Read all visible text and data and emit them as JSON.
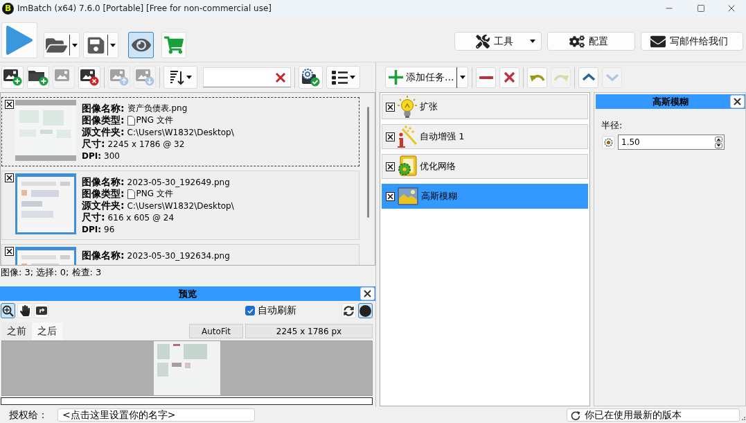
{
  "window": {
    "logo": "B",
    "title": "ImBatch (x64) 7.6.0 [Portable] [Free for non-commercial use]"
  },
  "main_toolbar": [
    {
      "kind": "run",
      "on": false
    },
    {
      "kind": "open",
      "on": false
    },
    {
      "kind": "save",
      "on": false
    },
    {
      "kind": "preview",
      "on": true
    },
    {
      "kind": "shop",
      "on": false
    }
  ],
  "top_buttons": [
    {
      "kind": "tools",
      "label": "工具"
    },
    {
      "kind": "config",
      "label": "配置"
    },
    {
      "kind": "mail",
      "label": "写邮件给我们"
    }
  ],
  "image_toolbar": [
    [
      {
        "kind": "add-image",
        "disabled": false
      },
      {
        "kind": "add-folder",
        "disabled": false
      },
      {
        "kind": "edit-image",
        "disabled": true
      },
      {
        "kind": "remove-image",
        "disabled": false
      }
    ],
    [
      {
        "kind": "move-up",
        "disabled": true
      },
      {
        "kind": "move-down",
        "disabled": true
      }
    ],
    [
      {
        "kind": "sort",
        "disabled": false
      },
      {
        "kind": "search"
      }
    ],
    [
      {
        "kind": "check",
        "disabled": false
      },
      {
        "kind": "view",
        "disabled": false
      }
    ]
  ],
  "image_list": [
    {
      "kind": "document",
      "checked": true,
      "focused": true,
      "fields": [
        {
          "kind": "name",
          "label": "图像名称:",
          "value": "资产负债表.png"
        },
        {
          "kind": "type",
          "label": "图像类型:",
          "value": "PNG 文件"
        },
        {
          "kind": "folder",
          "label": "源文件夹:",
          "value": "C:\\Users\\W1832\\Desktop\\"
        },
        {
          "kind": "size",
          "label": "尺寸:",
          "value": "2245 x 1786 @ 32"
        },
        {
          "kind": "dpi",
          "label": "DPI:",
          "value": "300"
        }
      ]
    },
    {
      "kind": "screenshot",
      "checked": true,
      "focused": false,
      "fields": [
        {
          "kind": "name",
          "label": "图像名称:",
          "value": "2023-05-30_192649.png"
        },
        {
          "kind": "type",
          "label": "图像类型:",
          "value": "PNG 文件"
        },
        {
          "kind": "folder",
          "label": "源文件夹:",
          "value": "C:\\Users\\W1832\\Desktop\\"
        },
        {
          "kind": "size",
          "label": "尺寸:",
          "value": "616 x 605 @ 24"
        },
        {
          "kind": "dpi",
          "label": "DPI:",
          "value": "96"
        }
      ]
    },
    {
      "kind": "screenshot",
      "checked": true,
      "focused": false,
      "fields": [
        {
          "kind": "name",
          "label": "图像名称:",
          "value": "2023-05-30_192634.png"
        }
      ]
    }
  ],
  "image_status": "图像: 3; 选择: 0; 检查: 3",
  "preview": {
    "title": "预览",
    "tools": [
      {
        "kind": "zoom",
        "selected": true
      },
      {
        "kind": "pan",
        "selected": false
      },
      {
        "kind": "rotate",
        "selected": false
      }
    ],
    "auto_refresh": {
      "label": "自动刷新",
      "checked": true
    },
    "view_buttons": [
      {
        "kind": "refresh",
        "selected": false
      },
      {
        "kind": "background",
        "selected": true
      }
    ],
    "tabs": [
      {
        "label": "之前",
        "selected": false
      },
      {
        "label": "之后",
        "selected": true
      }
    ],
    "fit_button": "AutoFit",
    "dimensions": "2245 x 1786 px"
  },
  "task_toolbar": {
    "add_label": "添加任务...",
    "groups": [
      [
        {
          "kind": "remove",
          "disabled": false
        },
        {
          "kind": "clear",
          "disabled": false
        }
      ],
      [
        {
          "kind": "undo",
          "disabled": false
        },
        {
          "kind": "redo",
          "disabled": true
        }
      ],
      [
        {
          "kind": "up",
          "disabled": false
        },
        {
          "kind": "down",
          "disabled": true
        }
      ]
    ]
  },
  "tasks": [
    {
      "kind": "expand",
      "label": "扩张",
      "checked": true,
      "selected": false
    },
    {
      "kind": "enhance",
      "label": "自动增强 1",
      "checked": true,
      "selected": false
    },
    {
      "kind": "optimize",
      "label": "优化网络",
      "checked": true,
      "selected": false
    },
    {
      "kind": "blur",
      "label": "高斯模糊",
      "checked": true,
      "selected": true
    }
  ],
  "properties": {
    "title": "高斯模糊",
    "fields": [
      {
        "label": "半径:",
        "value": "1.50"
      }
    ]
  },
  "license": {
    "label": "授权给：",
    "value": "<点击这里设置你的名字>"
  },
  "update_status": "你已在使用最新的版本"
}
